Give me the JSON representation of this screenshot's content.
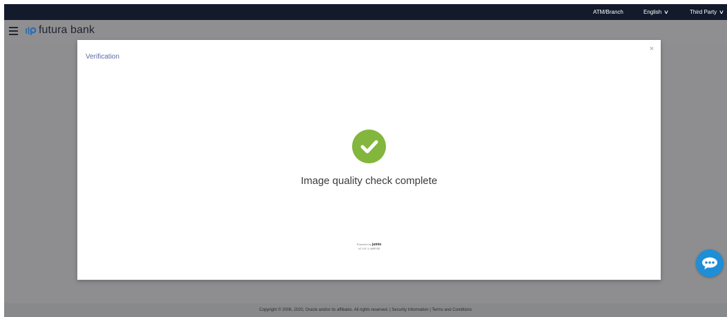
{
  "topbar": {
    "atm_branch": "ATM/Branch",
    "language": "English",
    "third_party": "Third Party"
  },
  "header": {
    "logo_text": "futura bank"
  },
  "modal": {
    "title": "Verification",
    "close": "×",
    "status": "Image quality check complete",
    "powered_by": "Powered by",
    "powered_brand": "jumio",
    "version": "v2.141.1-4d5f038"
  },
  "footer": {
    "text": "Copyright © 2006, 2020, Oracle and/or its affiliates. All rights reserved. | Security Information | Terms and Conditions"
  },
  "colors": {
    "topbar": "#121a2b",
    "check": "#83b63c",
    "chat": "#1e8ed6",
    "title": "#5b6aa3"
  },
  "icons": [
    "menu-icon",
    "logo-icon",
    "chevron-down-icon",
    "close-icon",
    "checkmark-icon",
    "chat-icon"
  ]
}
